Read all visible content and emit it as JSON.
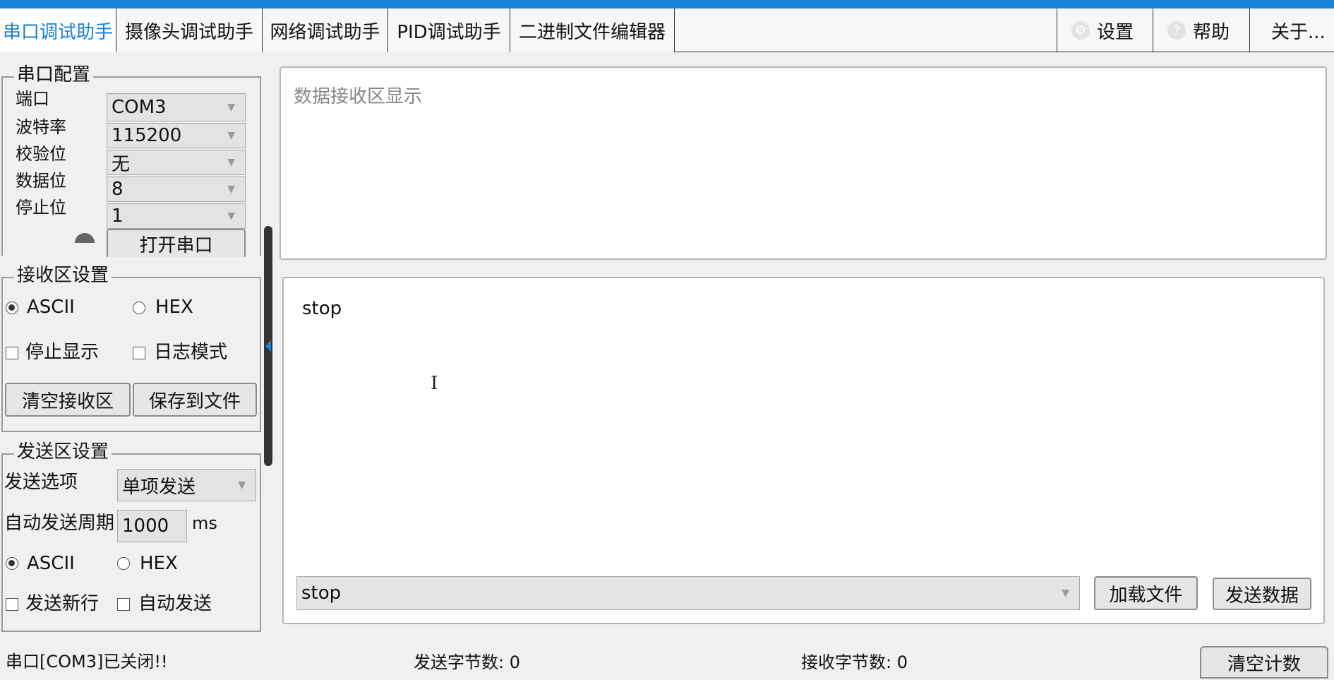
{
  "tabs": [
    {
      "label": "串口调试助手",
      "active": true
    },
    {
      "label": "摄像头调试助手"
    },
    {
      "label": "网络调试助手"
    },
    {
      "label": "PID调试助手"
    },
    {
      "label": "二进制文件编辑器"
    }
  ],
  "right_tabs": {
    "settings": {
      "label": "设置",
      "icon": "gear-icon"
    },
    "help": {
      "label": "帮助",
      "icon": "question-icon"
    },
    "about": {
      "label": "关于..."
    }
  },
  "serial_config": {
    "title": "串口配置",
    "port_label": "端口",
    "port_value": "COM3",
    "baud_label": "波特率",
    "baud_value": "115200",
    "parity_label": "校验位",
    "parity_value": "无",
    "databits_label": "数据位",
    "databits_value": "8",
    "stopbits_label": "停止位",
    "stopbits_value": "1",
    "open_button": "打开串口"
  },
  "receive_settings": {
    "title": "接收区设置",
    "ascii_label": "ASCII",
    "hex_label": "HEX",
    "stop_display_label": "停止显示",
    "log_mode_label": "日志模式",
    "clear_button": "清空接收区",
    "save_button": "保存到文件"
  },
  "send_settings": {
    "title": "发送区设置",
    "option_label": "发送选项",
    "option_value": "单项发送",
    "period_label": "自动发送周期",
    "period_value": "1000",
    "period_unit": "ms",
    "ascii_label": "ASCII",
    "hex_label": "HEX",
    "newline_label": "发送新行",
    "auto_send_label": "自动发送"
  },
  "receive_area": {
    "placeholder": "数据接收区显示"
  },
  "send_area": {
    "text": "stop",
    "combo_value": "stop",
    "load_button": "加载文件",
    "send_button": "发送数据"
  },
  "status_bar": {
    "port_status": "串口[COM3]已关闭!!",
    "sent_bytes": "发送字节数: 0",
    "recv_bytes": "接收字节数: 0",
    "clear_count_button": "清空计数"
  },
  "colors": {
    "accent": "#1683d8",
    "active_tab_text": "#1a7fd0"
  }
}
